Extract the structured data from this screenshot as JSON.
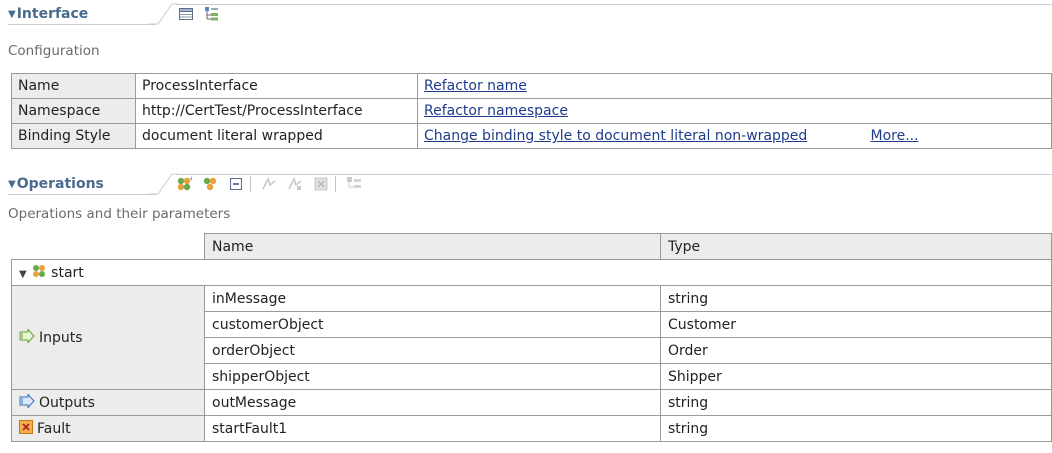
{
  "interface": {
    "title": "Interface",
    "subtitle": "Configuration",
    "toolbar": [
      {
        "icon": "table-icon"
      },
      {
        "icon": "tree-icon"
      }
    ],
    "rows": [
      {
        "label": "Name",
        "value": "ProcessInterface",
        "action": "Refactor name",
        "extra": ""
      },
      {
        "label": "Namespace",
        "value": "http://CertTest/ProcessInterface",
        "action": "Refactor namespace",
        "extra": ""
      },
      {
        "label": "Binding Style",
        "value": "document literal wrapped",
        "action": "Change binding style to document literal non-wrapped",
        "extra": "More..."
      }
    ]
  },
  "operations": {
    "title": "Operations",
    "subtitle": "Operations and their parameters",
    "toolbar": [
      {
        "icon": "add-request-response-operation-icon"
      },
      {
        "icon": "add-one-way-operation-icon"
      },
      {
        "icon": "collapse-all-icon"
      },
      {
        "icon": "add-input-icon"
      },
      {
        "icon": "add-output-icon"
      },
      {
        "icon": "add-fault-icon"
      },
      {
        "icon": "show-layout-icon"
      }
    ],
    "columns": {
      "name": "Name",
      "type": "Type"
    },
    "operation": {
      "name": "start",
      "icon": "operation-icon"
    },
    "inputs": {
      "label": "Inputs",
      "icon": "input-arrow-icon",
      "params": [
        {
          "name": "inMessage",
          "type": "string"
        },
        {
          "name": "customerObject",
          "type": "Customer"
        },
        {
          "name": "orderObject",
          "type": "Order"
        },
        {
          "name": "shipperObject",
          "type": "Shipper"
        }
      ]
    },
    "outputs": {
      "label": "Outputs",
      "icon": "output-arrow-icon",
      "params": [
        {
          "name": "outMessage",
          "type": "string"
        }
      ]
    },
    "fault": {
      "label": "Fault",
      "icon": "fault-icon",
      "params": [
        {
          "name": "startFault1",
          "type": "string"
        }
      ]
    }
  }
}
